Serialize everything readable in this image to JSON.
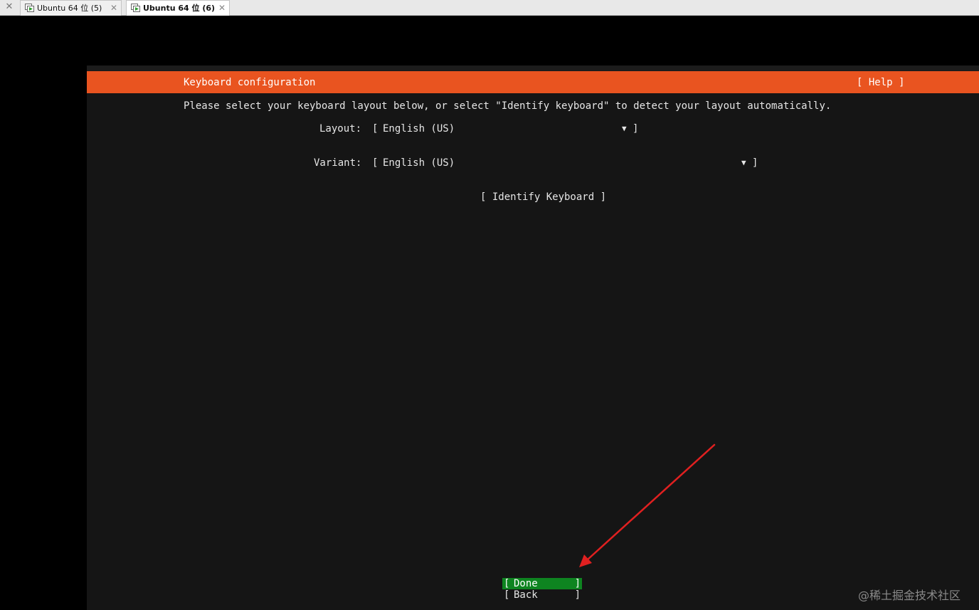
{
  "tabs": [
    {
      "label": "Ubuntu 64 位 (5)",
      "active": false
    },
    {
      "label": "Ubuntu 64 位 (6)",
      "active": true
    }
  ],
  "installer": {
    "title": "Keyboard configuration",
    "help_label": "[ Help ]",
    "intro": "Please select your keyboard layout below, or select \"Identify keyboard\" to detect your layout automatically.",
    "layout": {
      "label": "Layout:",
      "value": "English (US)"
    },
    "variant": {
      "label": "Variant:",
      "value": "English (US)"
    },
    "identify_label": "[ Identify Keyboard ]",
    "done_label": "Done",
    "back_label": "Back",
    "bracket_open": "[",
    "bracket_close": "]",
    "dropdown_arrow": "▼"
  },
  "colors": {
    "header": "#e95420",
    "focus": "#0e8420",
    "background": "#151515",
    "annotation_arrow": "#e02020"
  },
  "watermark": "@稀土掘金技术社区"
}
